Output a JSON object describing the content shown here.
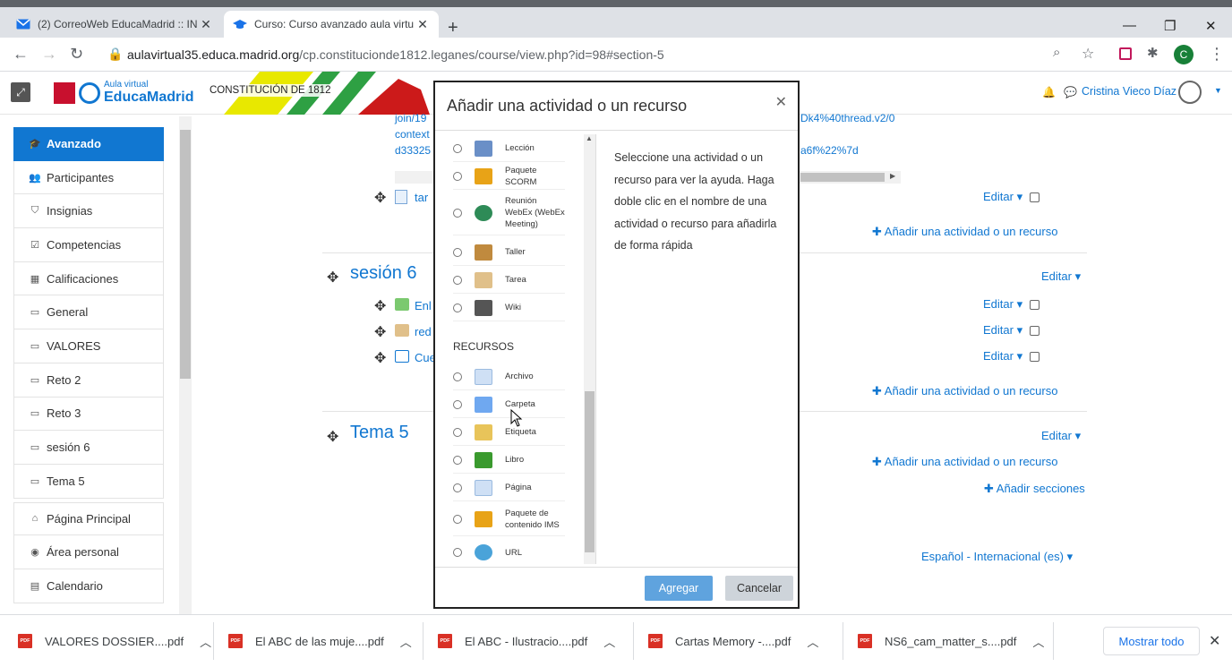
{
  "browser": {
    "tabs": [
      {
        "label": "(2) CorreoWeb EducaMadrid :: IN"
      },
      {
        "label": "Curso: Curso avanzado aula virtu"
      }
    ],
    "url_host": "aulavirtual35.educa.madrid.org",
    "url_path": "/cp.constituciondе1812.leganes/course/view.php?id=98#section-5",
    "profile_initial": "C"
  },
  "header": {
    "logo_small": "Aula virtual",
    "logo_big": "EducaMadrid",
    "school": "CONSTITUCIÓN DE 1812",
    "user": "Cristina Vieco Díaz"
  },
  "sidebar": {
    "items": [
      {
        "label": "Avanzado",
        "icon": "graduation-cap-icon"
      },
      {
        "label": "Participantes",
        "icon": "users-icon"
      },
      {
        "label": "Insignias",
        "icon": "shield-icon"
      },
      {
        "label": "Competencias",
        "icon": "checkbox-icon"
      },
      {
        "label": "Calificaciones",
        "icon": "table-icon"
      },
      {
        "label": "General",
        "icon": "folder-icon"
      },
      {
        "label": "VALORES",
        "icon": "folder-icon"
      },
      {
        "label": "Reto 2",
        "icon": "folder-icon"
      },
      {
        "label": "Reto 3",
        "icon": "folder-icon"
      },
      {
        "label": "sesión 6",
        "icon": "folder-icon"
      },
      {
        "label": "Tema 5",
        "icon": "folder-icon"
      }
    ],
    "bottom_items": [
      {
        "label": "Página Principal",
        "icon": "home-icon"
      },
      {
        "label": "Área personal",
        "icon": "dashboard-icon"
      },
      {
        "label": "Calendario",
        "icon": "calendar-icon"
      }
    ]
  },
  "content": {
    "link_line1_left": "join/19",
    "link_line1_right": "Dk4%40thread.v2/0",
    "link_line2_left": "context",
    "link_line3_left": "d33325",
    "link_line3_right": "a6f%22%7d",
    "row_tar": "tar",
    "edit_label": "Editar",
    "add_activity": "Añadir una actividad o un recurso",
    "section6_title": "sesión 6",
    "s6_items": [
      "Enl",
      "red",
      "Cue"
    ],
    "tema5_title": "Tema 5",
    "add_sections": "Añadir secciones",
    "language": "Español - Internacional (es)"
  },
  "modal": {
    "title": "Añadir una actividad o un recurso",
    "activities": [
      {
        "label": "Lección",
        "color": "#6a8fc7"
      },
      {
        "label": "Paquete SCORM",
        "color": "#e8a317"
      },
      {
        "label": "Reunión WebEx (WebEx Meeting)",
        "color": "#2e8b57"
      },
      {
        "label": "Taller",
        "color": "#c08a3e"
      },
      {
        "label": "Tarea",
        "color": "#e0c08a"
      },
      {
        "label": "Wiki",
        "color": "#555555"
      }
    ],
    "resources_heading": "RECURSOS",
    "resources": [
      {
        "label": "Archivo",
        "color": "#cfe0f5"
      },
      {
        "label": "Carpeta",
        "color": "#6fa8f0"
      },
      {
        "label": "Etiqueta",
        "color": "#e8c45a"
      },
      {
        "label": "Libro",
        "color": "#3a9a2e"
      },
      {
        "label": "Página",
        "color": "#cfe0f5"
      },
      {
        "label": "Paquete de contenido IMS",
        "color": "#e8a317"
      },
      {
        "label": "URL",
        "color": "#4aa3d9"
      }
    ],
    "help": "Seleccione una actividad o un recurso para ver la ayuda. Haga doble clic en el nombre de una actividad o recurso para añadirla de forma rápida",
    "add_button": "Agregar",
    "cancel_button": "Cancelar"
  },
  "downloads": {
    "files": [
      "VALORES DOSSIER....pdf",
      "El ABC de las muje....pdf",
      "El ABC - Ilustracio....pdf",
      "Cartas Memory -....pdf",
      "NS6_cam_matter_s....pdf"
    ],
    "show_all": "Mostrar todo"
  }
}
